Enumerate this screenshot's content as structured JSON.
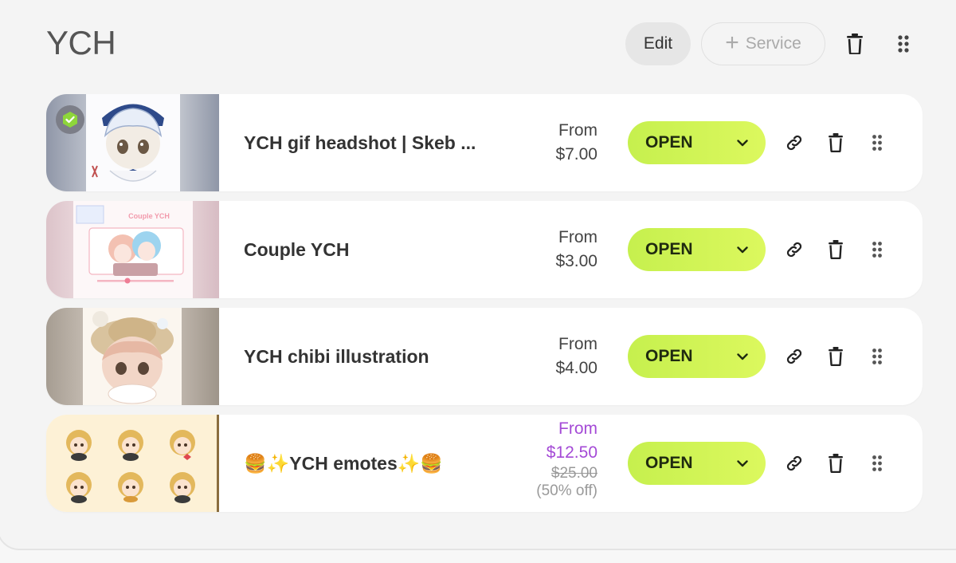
{
  "header": {
    "title": "YCH",
    "edit_label": "Edit",
    "service_label": "Service",
    "plus_glyph": "+"
  },
  "colors": {
    "status_accent": "#c6f04e",
    "sale_price": "#a44ad6",
    "check_badge": "#8ed63a"
  },
  "services": [
    {
      "title": "YCH gif headshot | Skeb ...",
      "price_prefix": "From",
      "price": "$7.00",
      "status": "OPEN",
      "verified": true
    },
    {
      "title": "Couple YCH",
      "price_prefix": "From",
      "price": "$3.00",
      "status": "OPEN",
      "thumb_caption": "Couple YCH"
    },
    {
      "title": "YCH chibi illustration",
      "price_prefix": "From",
      "price": "$4.00",
      "status": "OPEN"
    },
    {
      "title": "🍔✨YCH emotes✨🍔",
      "price_prefix": "From",
      "price": "$12.50",
      "original_price": "$25.00",
      "discount": "(50% off)",
      "status": "OPEN"
    }
  ]
}
